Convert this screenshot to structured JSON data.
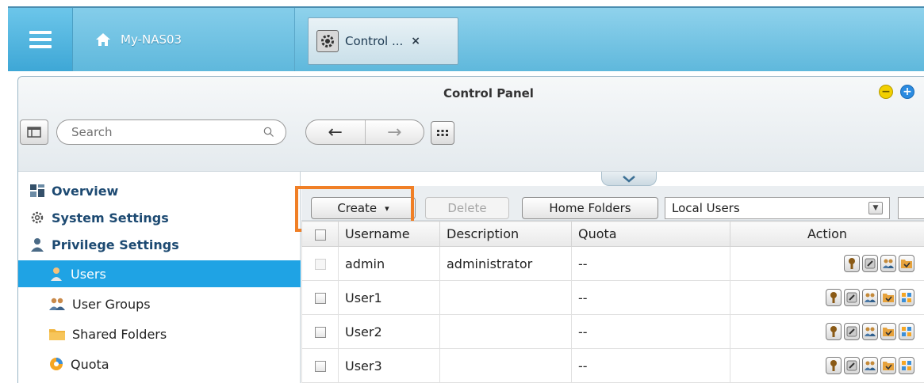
{
  "topbar": {
    "home_label": "My-NAS03",
    "tab_label": "Control ...",
    "tab_close": "×"
  },
  "window": {
    "title": "Control Panel",
    "minimize": "−",
    "maximize": "+"
  },
  "search": {
    "placeholder": "Search"
  },
  "nav": {
    "back": "←",
    "forward": "→"
  },
  "sidebar": {
    "items": [
      {
        "label": "Overview",
        "icon": "overview-icon",
        "level": "top"
      },
      {
        "label": "System Settings",
        "icon": "gear-icon",
        "level": "top"
      },
      {
        "label": "Privilege Settings",
        "icon": "person-icon",
        "level": "top"
      },
      {
        "label": "Users",
        "icon": "user-icon",
        "level": "sub",
        "active": true
      },
      {
        "label": "User Groups",
        "icon": "user-groups-icon",
        "level": "sub"
      },
      {
        "label": "Shared Folders",
        "icon": "folder-icon",
        "level": "sub"
      },
      {
        "label": "Quota",
        "icon": "quota-icon",
        "level": "sub"
      }
    ]
  },
  "toolbar": {
    "create_label": "Create",
    "create_arrow": "▾",
    "delete_label": "Delete",
    "home_folders_label": "Home Folders",
    "user_type_selected": "Local Users",
    "select_arrow": "▼"
  },
  "table": {
    "headers": {
      "username": "Username",
      "description": "Description",
      "quota": "Quota",
      "action": "Action"
    },
    "rows": [
      {
        "username": "admin",
        "description": "administrator",
        "quota": "--",
        "checkbox_enabled": false,
        "action_count": 4
      },
      {
        "username": "User1",
        "description": "",
        "quota": "--",
        "checkbox_enabled": true,
        "action_count": 5
      },
      {
        "username": "User2",
        "description": "",
        "quota": "--",
        "checkbox_enabled": true,
        "action_count": 5
      },
      {
        "username": "User3",
        "description": "",
        "quota": "--",
        "checkbox_enabled": true,
        "action_count": 5
      }
    ]
  },
  "colors": {
    "topbar": "#5fb8dc",
    "sidebar_active": "#1fa3e4",
    "highlight": "#f07f26",
    "sidebar_heading": "#1d4a72"
  }
}
